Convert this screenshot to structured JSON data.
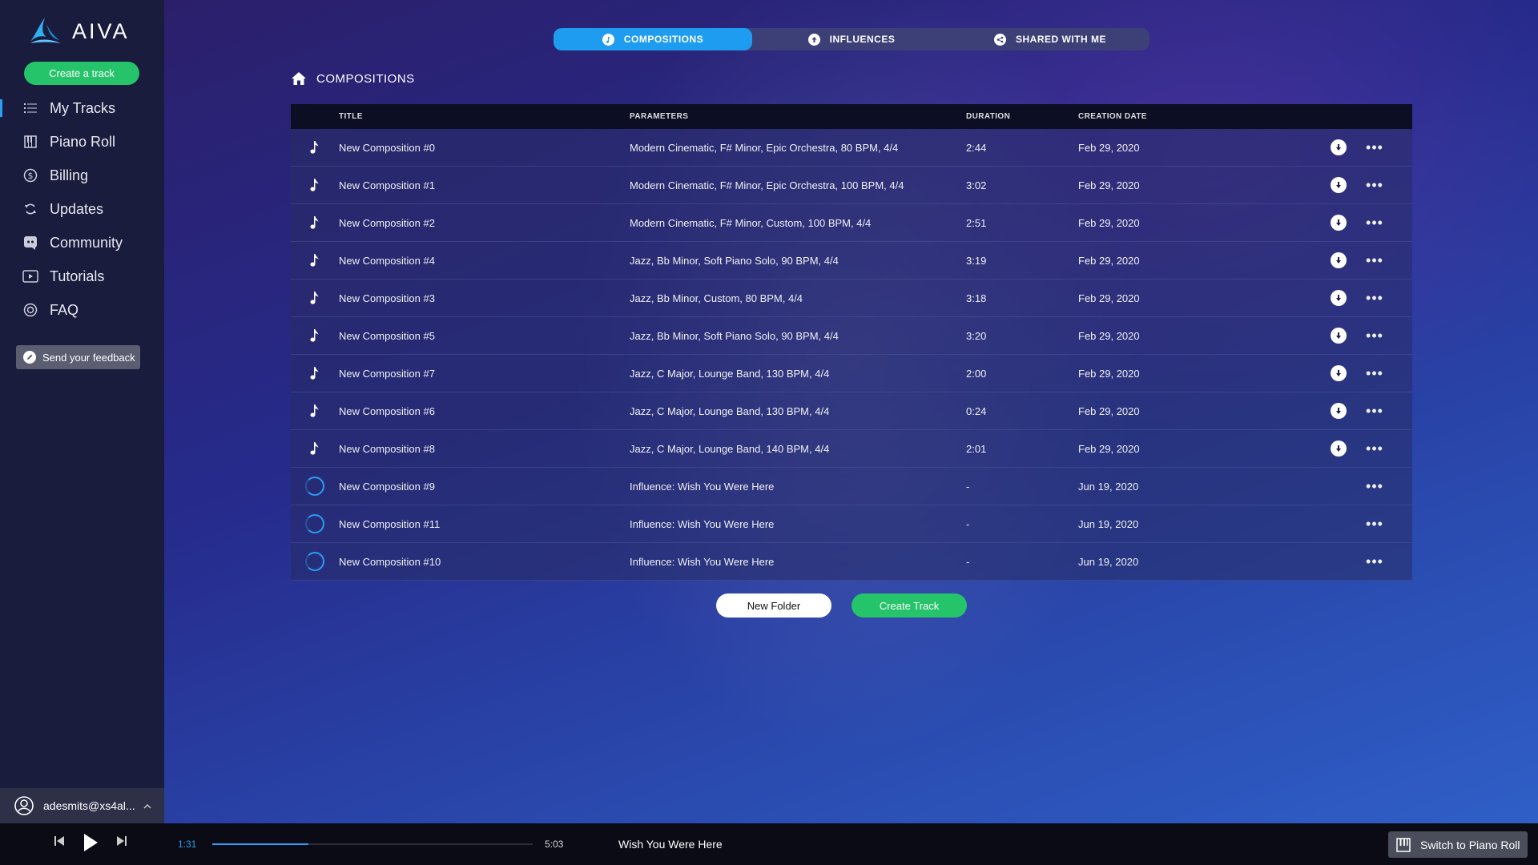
{
  "app": {
    "name": "AIVA",
    "create_label": "Create a track"
  },
  "nav": {
    "items": [
      {
        "label": "My Tracks",
        "icon": "list-icon",
        "active": true
      },
      {
        "label": "Piano Roll",
        "icon": "piano-icon"
      },
      {
        "label": "Billing",
        "icon": "dollar-icon"
      },
      {
        "label": "Updates",
        "icon": "refresh-icon"
      },
      {
        "label": "Community",
        "icon": "discord-icon"
      },
      {
        "label": "Tutorials",
        "icon": "play-box-icon"
      },
      {
        "label": "FAQ",
        "icon": "lifebuoy-icon"
      }
    ],
    "feedback_label": "Send your feedback"
  },
  "user": {
    "email": "adesmits@xs4al..."
  },
  "tabs": [
    {
      "label": "COMPOSITIONS",
      "active": true
    },
    {
      "label": "INFLUENCES"
    },
    {
      "label": "SHARED WITH ME"
    }
  ],
  "breadcrumb": "COMPOSITIONS",
  "table": {
    "headers": {
      "title": "TITLE",
      "parameters": "PARAMETERS",
      "duration": "DURATION",
      "date": "CREATION DATE"
    },
    "rows": [
      {
        "title": "New Composition #0",
        "params": "Modern Cinematic, F# Minor, Epic Orchestra, 80 BPM, 4/4",
        "duration": "2:44",
        "date": "Feb 29, 2020",
        "status": "ready"
      },
      {
        "title": "New Composition #1",
        "params": "Modern Cinematic, F# Minor, Epic Orchestra, 100 BPM, 4/4",
        "duration": "3:02",
        "date": "Feb 29, 2020",
        "status": "ready"
      },
      {
        "title": "New Composition #2",
        "params": "Modern Cinematic, F# Minor, Custom, 100 BPM, 4/4",
        "duration": "2:51",
        "date": "Feb 29, 2020",
        "status": "ready"
      },
      {
        "title": "New Composition #4",
        "params": "Jazz, Bb Minor, Soft Piano Solo, 90 BPM, 4/4",
        "duration": "3:19",
        "date": "Feb 29, 2020",
        "status": "ready"
      },
      {
        "title": "New Composition #3",
        "params": "Jazz, Bb Minor, Custom, 80 BPM, 4/4",
        "duration": "3:18",
        "date": "Feb 29, 2020",
        "status": "ready"
      },
      {
        "title": "New Composition #5",
        "params": "Jazz, Bb Minor, Soft Piano Solo, 90 BPM, 4/4",
        "duration": "3:20",
        "date": "Feb 29, 2020",
        "status": "ready"
      },
      {
        "title": "New Composition #7",
        "params": "Jazz, C Major, Lounge Band, 130 BPM, 4/4",
        "duration": "2:00",
        "date": "Feb 29, 2020",
        "status": "ready"
      },
      {
        "title": "New Composition #6",
        "params": "Jazz, C Major, Lounge Band, 130 BPM, 4/4",
        "duration": "0:24",
        "date": "Feb 29, 2020",
        "status": "ready"
      },
      {
        "title": "New Composition #8",
        "params": "Jazz, C Major, Lounge Band, 140 BPM, 4/4",
        "duration": "2:01",
        "date": "Feb 29, 2020",
        "status": "ready"
      },
      {
        "title": "New Composition #9",
        "params": "Influence: Wish You Were Here",
        "duration": "-",
        "date": "Jun 19, 2020",
        "status": "pending"
      },
      {
        "title": "New Composition #11",
        "params": "Influence: Wish You Were Here",
        "duration": "-",
        "date": "Jun 19, 2020",
        "status": "pending"
      },
      {
        "title": "New Composition #10",
        "params": "Influence: Wish You Were Here",
        "duration": "-",
        "date": "Jun 19, 2020",
        "status": "pending"
      }
    ]
  },
  "actions": {
    "new_folder": "New Folder",
    "create_track": "Create Track"
  },
  "player": {
    "current_time": "1:31",
    "total_time": "5:03",
    "progress": 0.3,
    "track_title": "Wish You Were Here",
    "switch_label": "Switch to Piano Roll"
  },
  "colors": {
    "accent": "#1e9cf0",
    "green": "#26c46a",
    "sidebar": "#1a1c3d"
  }
}
